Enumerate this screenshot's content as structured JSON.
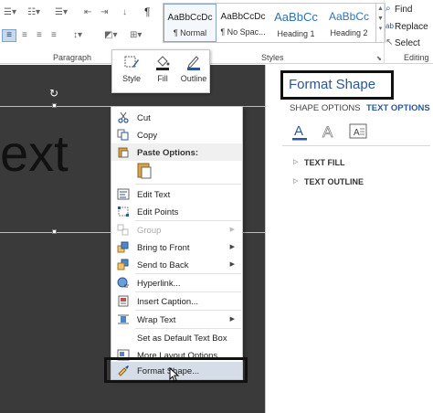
{
  "ribbon": {
    "groups": {
      "paragraph": "Paragraph",
      "styles": "Styles",
      "editing": "Editing"
    },
    "styles": [
      {
        "preview": "AaBbCcDc",
        "name": "¶ Normal",
        "selected": true
      },
      {
        "preview": "AaBbCcDc",
        "name": "¶ No Spac...",
        "selected": false
      },
      {
        "preview": "AaBbCc",
        "name": "Heading 1",
        "selected": false,
        "heading": true
      },
      {
        "preview": "AaBbCc",
        "name": "Heading 2",
        "selected": false,
        "heading": true
      }
    ],
    "editing": {
      "find": "Find",
      "replace": "Replace",
      "select": "Select"
    },
    "pilcrow": "¶"
  },
  "canvas": {
    "text": "ext"
  },
  "mini_toolbar": {
    "style": "Style",
    "fill": "Fill",
    "outline": "Outline"
  },
  "context_menu": {
    "cut": "Cut",
    "copy": "Copy",
    "paste_options": "Paste Options:",
    "edit_text": "Edit Text",
    "edit_points": "Edit Points",
    "group": "Group",
    "bring_to_front": "Bring to Front",
    "send_to_back": "Send to Back",
    "hyperlink": "Hyperlink...",
    "insert_caption": "Insert Caption...",
    "wrap_text": "Wrap Text",
    "set_default": "Set as Default Text Box",
    "more_layout": "More Layout Options...",
    "format_shape": "Format Shape..."
  },
  "pane": {
    "title": "Format Shape",
    "tabs": {
      "shape_options": "SHAPE OPTIONS",
      "text_options": "TEXT OPTIONS"
    },
    "sections": {
      "text_fill": "TEXT FILL",
      "text_outline": "TEXT OUTLINE"
    }
  },
  "colors": {
    "accent": "#2b579a",
    "doc_bg": "#3a3a3a",
    "menu_highlight": "#d5dde8"
  }
}
